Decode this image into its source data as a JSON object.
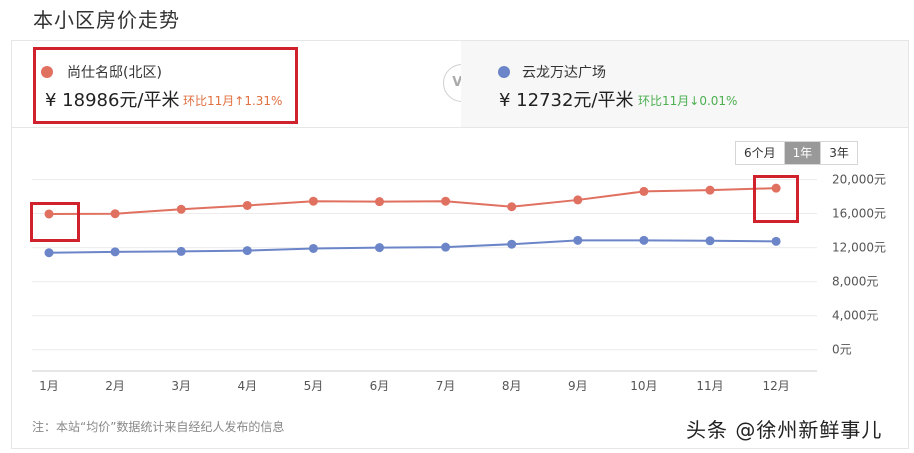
{
  "page": {
    "title": "本小区房价走势"
  },
  "left": {
    "name": "尚仕名邸(北区)",
    "price": "¥ 18986元/平米",
    "change": "环比11月↑1.31%",
    "dot_color": "#e07060",
    "change_color": "#e07040"
  },
  "vs": "VS",
  "right": {
    "name": "云龙万达广场",
    "price": "¥ 12732元/平米",
    "change": "环比11月↓0.01%",
    "dot_color": "#6b85c8",
    "change_color": "#4caf50"
  },
  "tabs": [
    {
      "label": "6个月",
      "active": false
    },
    {
      "label": "1年",
      "active": true
    },
    {
      "label": "3年",
      "active": false
    }
  ],
  "note": "注：本站“均价”数据统计来自经纪人发布的信息",
  "watermark": "头条 @徐州新鲜事儿",
  "chart_data": {
    "type": "line",
    "categories": [
      "1月",
      "2月",
      "3月",
      "4月",
      "5月",
      "6月",
      "7月",
      "8月",
      "9月",
      "10月",
      "11月",
      "12月"
    ],
    "series": [
      {
        "name": "尚仕名邸(北区)",
        "color": "#e07060",
        "values": [
          15950,
          15980,
          16500,
          16950,
          17450,
          17400,
          17450,
          16800,
          17600,
          18600,
          18750,
          18986
        ]
      },
      {
        "name": "云龙万达广场",
        "color": "#6b85c8",
        "values": [
          11400,
          11500,
          11550,
          11650,
          11900,
          12000,
          12050,
          12400,
          12850,
          12850,
          12800,
          12732
        ]
      }
    ],
    "y_ticks": [
      "0元",
      "4,000元",
      "8,000元",
      "12,000元",
      "16,000元",
      "20,000元"
    ],
    "y_tick_values": [
      0,
      4000,
      8000,
      12000,
      16000,
      20000
    ],
    "ylim": [
      -2500,
      21000
    ],
    "grid": true
  }
}
